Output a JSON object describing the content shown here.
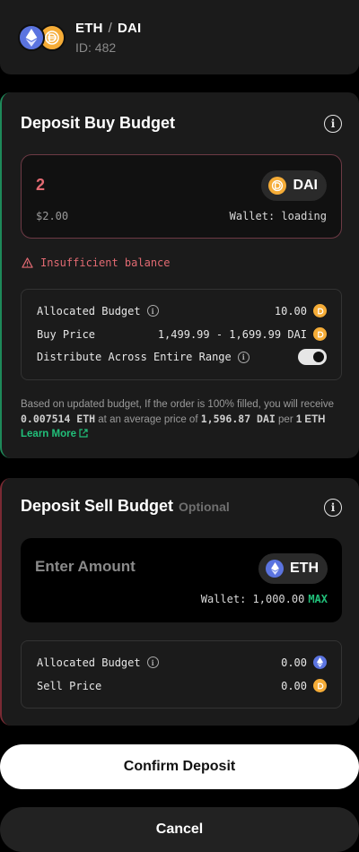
{
  "pair": {
    "base": "ETH",
    "separator": "/",
    "quote": "DAI",
    "id": "ID: 482"
  },
  "buy": {
    "title": "Deposit Buy Budget",
    "amount": "2",
    "token": "DAI",
    "fiat": "$2.00",
    "wallet": "Wallet: loading",
    "warning": "Insufficient balance",
    "allocated_label": "Allocated Budget",
    "allocated_value": "10.00",
    "price_label": "Buy Price",
    "price_value": "1,499.99 - 1,699.99 DAI",
    "distribute_label": "Distribute Across Entire Range",
    "distribute_enabled": true,
    "summary_pre": "Based on updated budget, If the order is 100% filled, you will receive ",
    "summary_amount": "0.007514 ETH",
    "summary_mid": " at an average price of ",
    "summary_price": "1,596.87 DAI",
    "summary_post1": " per ",
    "summary_unit": "1 ETH",
    "learn_more": "Learn More"
  },
  "sell": {
    "title": "Deposit Sell Budget",
    "optional": "Optional",
    "placeholder": "Enter Amount",
    "token": "ETH",
    "wallet": "Wallet: 1,000.00",
    "max": "MAX",
    "allocated_label": "Allocated Budget",
    "allocated_value": "0.00",
    "price_label": "Sell Price",
    "price_value": "0.00"
  },
  "actions": {
    "confirm": "Confirm Deposit",
    "cancel": "Cancel"
  },
  "colors": {
    "accent_green": "#21c07a",
    "error_red": "#e26a72",
    "eth": "#5b74e0",
    "dai": "#f5ac37"
  }
}
